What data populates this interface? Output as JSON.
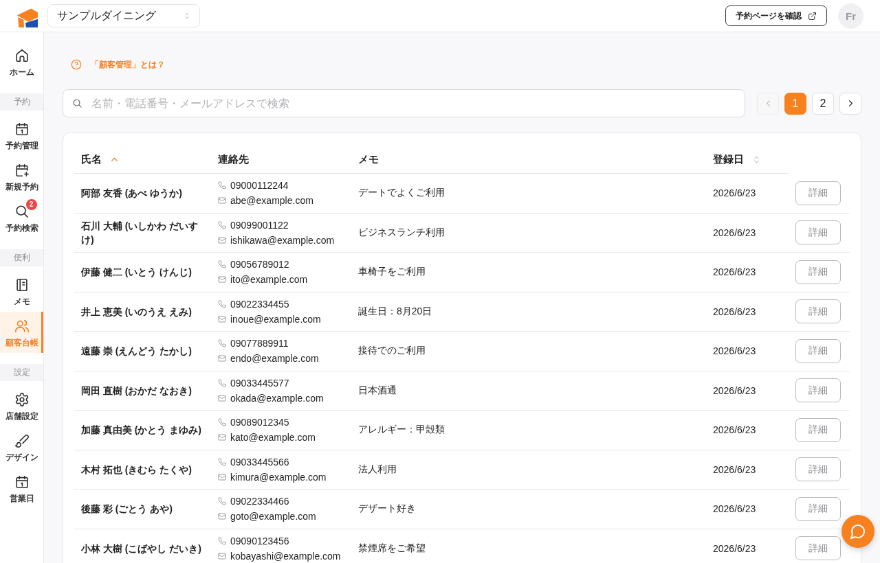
{
  "header": {
    "store_select": {
      "value": "サンプルダイニング"
    },
    "preview_button": {
      "label": "予約ページを確認"
    },
    "avatar": {
      "initials": "Fr"
    }
  },
  "sidebar": {
    "sections": [
      {
        "items": [
          {
            "label": "ホーム",
            "selected": false
          }
        ]
      },
      {
        "title": "予約",
        "items": [
          {
            "label": "予約管理",
            "selected": false
          },
          {
            "label": "新規予約",
            "selected": false
          },
          {
            "label": "予約検索",
            "selected": false,
            "badge": "2"
          }
        ]
      },
      {
        "title": "便利",
        "items": [
          {
            "label": "メモ",
            "selected": false
          },
          {
            "label": "顧客台帳",
            "selected": true
          }
        ]
      },
      {
        "title": "設定",
        "items": [
          {
            "label": "店舗設定",
            "selected": false
          },
          {
            "label": "デザイン",
            "selected": false
          },
          {
            "label": "営業日",
            "selected": false
          }
        ]
      }
    ]
  },
  "help_link": {
    "label": "「顧客管理」とは？"
  },
  "search": {
    "placeholder": "名前・電話番号・メールアドレスで検索"
  },
  "pagination": {
    "previous": {
      "disabled": true
    },
    "pages": [
      {
        "label": "1",
        "selected": true
      },
      {
        "label": "2",
        "selected": false
      }
    ],
    "next": {
      "disabled": false
    }
  },
  "table": {
    "columns": [
      {
        "label": "氏名",
        "sorted": true
      },
      {
        "label": "連絡先"
      },
      {
        "label": "メモ"
      },
      {
        "label": "登録日",
        "sorted": false
      }
    ],
    "rows": [
      {
        "name": "阿部 友香 (あべ ゆうか)",
        "phone": "09000112244",
        "email": "abe@example.com",
        "memo": "デートでよくご利用",
        "registered": "2026/6/23",
        "action": "詳細"
      },
      {
        "name": "石川 大輔 (いしかわ だいすけ)",
        "phone": "09099001122",
        "email": "ishikawa@example.com",
        "memo": "ビジネスランチ利用",
        "registered": "2026/6/23",
        "action": "詳細"
      },
      {
        "name": "伊藤 健二 (いとう けんじ)",
        "phone": "09056789012",
        "email": "ito@example.com",
        "memo": "車椅子をご利用",
        "registered": "2026/6/23",
        "action": "詳細"
      },
      {
        "name": "井上 恵美 (いのうえ えみ)",
        "phone": "09022334455",
        "email": "inoue@example.com",
        "memo": "誕生日：8月20日",
        "registered": "2026/6/23",
        "action": "詳細"
      },
      {
        "name": "遠藤 崇 (えんどう たかし)",
        "phone": "09077889911",
        "email": "endo@example.com",
        "memo": "接待でのご利用",
        "registered": "2026/6/23",
        "action": "詳細"
      },
      {
        "name": "岡田 直樹 (おかだ なおき)",
        "phone": "09033445577",
        "email": "okada@example.com",
        "memo": "日本酒通",
        "registered": "2026/6/23",
        "action": "詳細"
      },
      {
        "name": "加藤 真由美 (かとう まゆみ)",
        "phone": "09089012345",
        "email": "kato@example.com",
        "memo": "アレルギー：甲殻類",
        "registered": "2026/6/23",
        "action": "詳細"
      },
      {
        "name": "木村 拓也 (きむら たくや)",
        "phone": "09033445566",
        "email": "kimura@example.com",
        "memo": "法人利用",
        "registered": "2026/6/23",
        "action": "詳細"
      },
      {
        "name": "後藤 彩 (ごとう あや)",
        "phone": "09022334466",
        "email": "goto@example.com",
        "memo": "デザート好き",
        "registered": "2026/6/23",
        "action": "詳細"
      },
      {
        "name": "小林 大樹 (こばやし だいき)",
        "phone": "09090123456",
        "email": "kobayashi@example.com",
        "memo": "禁煙席をご希望",
        "registered": "2026/6/23",
        "action": "詳細"
      }
    ]
  }
}
